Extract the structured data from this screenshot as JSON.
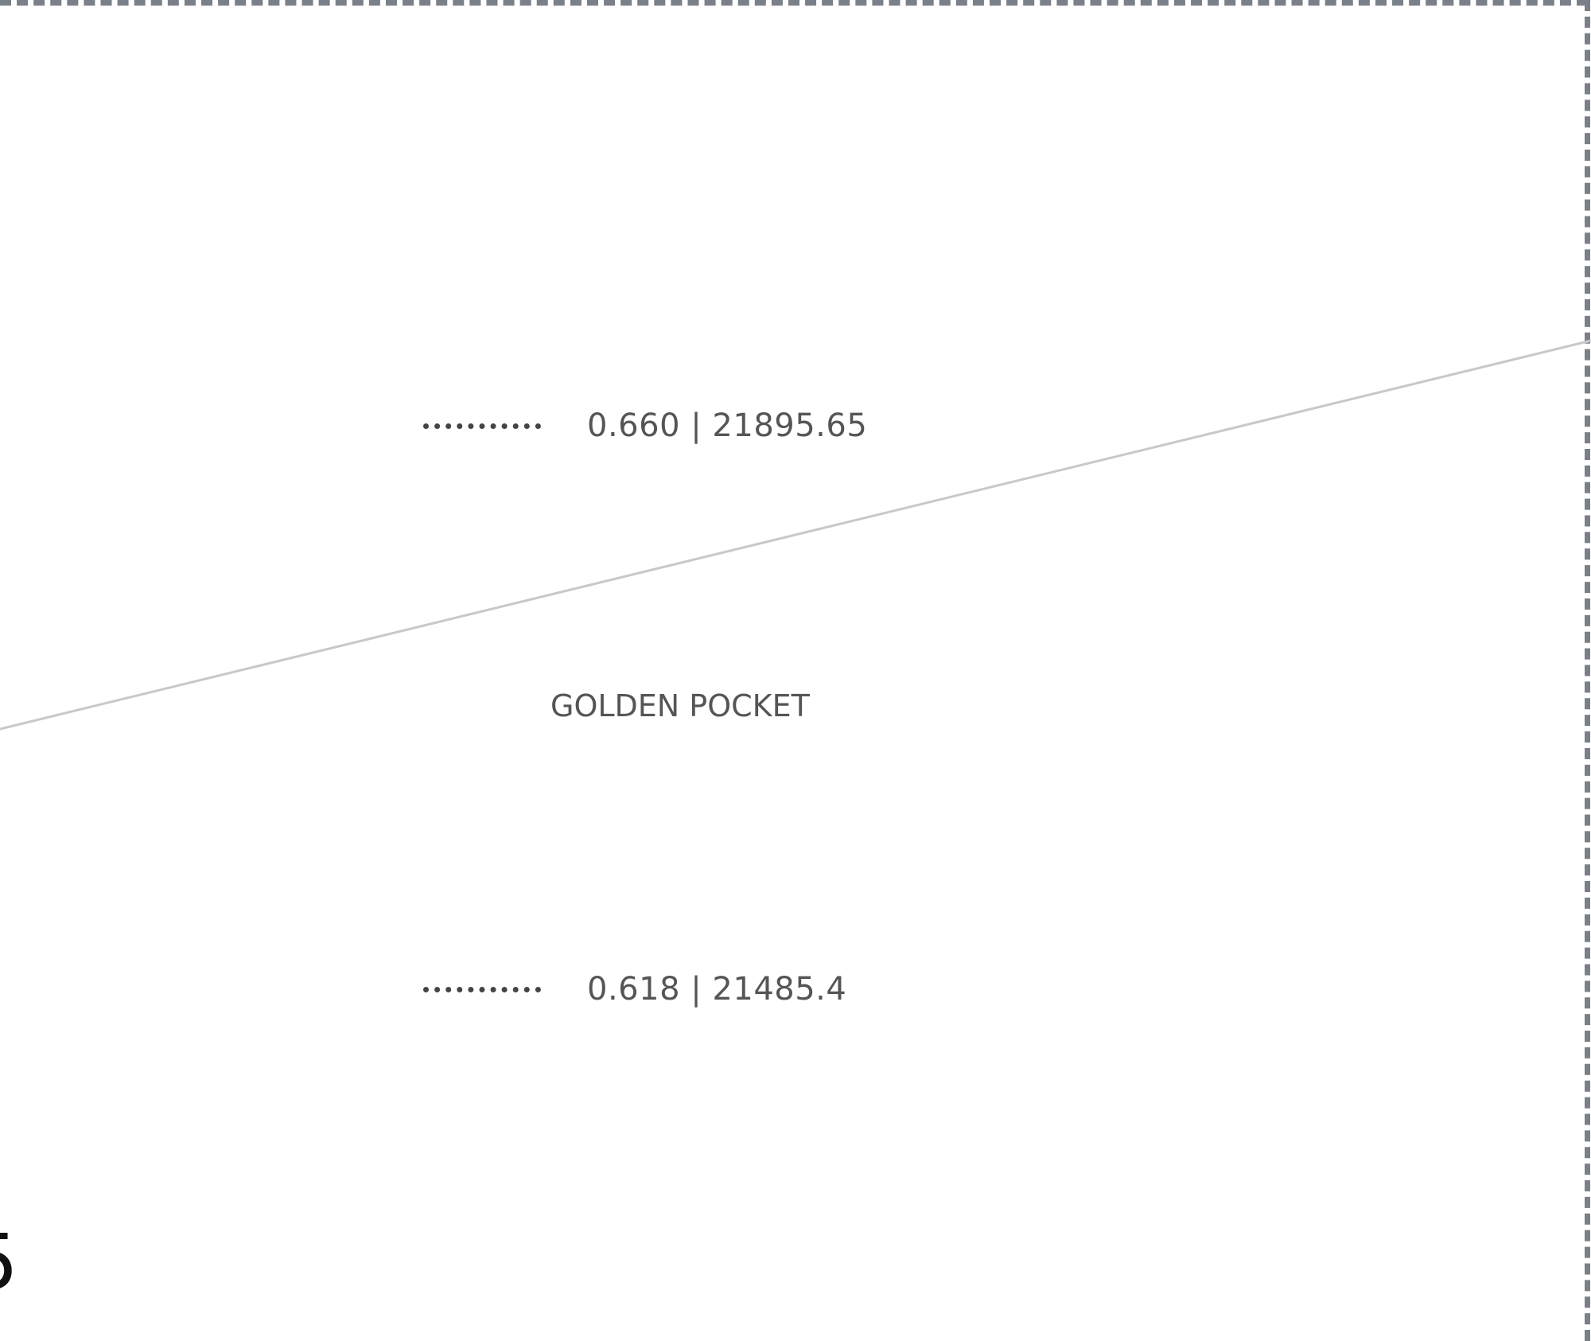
{
  "drawing": {
    "frame_color": "#7a8089",
    "trend_color": "#c8c8c8",
    "text_color": "#555555",
    "levels": [
      {
        "ratio": "0.660",
        "price": "21895.65",
        "label": "0.660 | 21895.65"
      },
      {
        "ratio": "0.618",
        "price": "21485.4",
        "label": "0.618 | 21485.4"
      }
    ],
    "zone_label": "GOLDEN POCKET",
    "edge_fragment": "5"
  }
}
